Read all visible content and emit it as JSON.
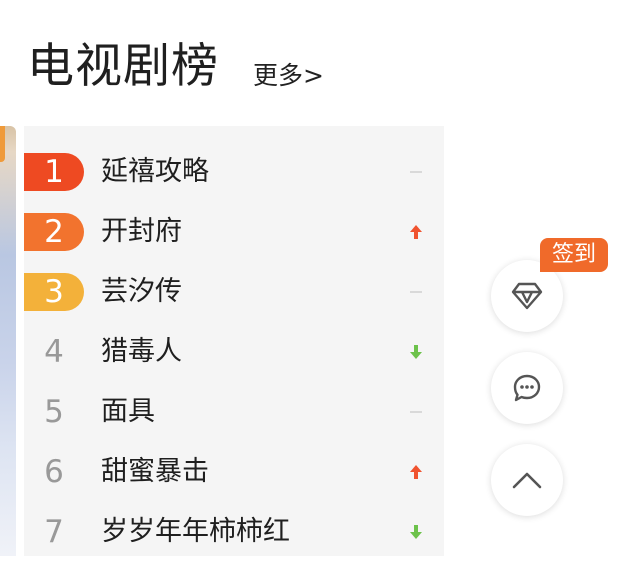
{
  "section": {
    "title": "电视剧榜",
    "more_label": "更多>"
  },
  "ranking": [
    {
      "rank": "1",
      "name": "延禧攻略",
      "trend": "flat",
      "badge_color": "#ee4a22"
    },
    {
      "rank": "2",
      "name": "开封府",
      "trend": "up",
      "badge_color": "#f2732e"
    },
    {
      "rank": "3",
      "name": "芸汐传",
      "trend": "flat",
      "badge_color": "#f3b13a"
    },
    {
      "rank": "4",
      "name": "猎毒人",
      "trend": "down"
    },
    {
      "rank": "5",
      "name": "面具",
      "trend": "flat"
    },
    {
      "rank": "6",
      "name": "甜蜜暴击",
      "trend": "up"
    },
    {
      "rank": "7",
      "name": "岁岁年年柿柿红",
      "trend": "down"
    }
  ],
  "colors": {
    "trend_up": "#f0532f",
    "trend_down": "#6cc24a",
    "trend_flat": "#d9d9d9"
  },
  "floating": {
    "checkin_label": "签到",
    "buttons": [
      "diamond-icon",
      "chat-bubble-icon",
      "back-to-top-icon"
    ]
  }
}
